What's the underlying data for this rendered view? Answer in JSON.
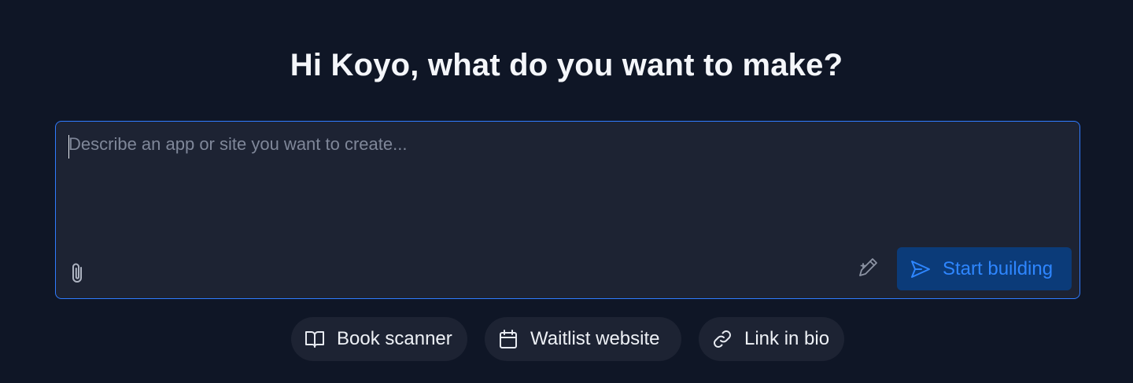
{
  "heading": "Hi Koyo, what do you want to make?",
  "prompt": {
    "placeholder": "Describe an app or site you want to create...",
    "value": ""
  },
  "actions": {
    "attach_icon": "paperclip-icon",
    "enhance_icon": "pen-sparkle-icon",
    "start_label": "Start building",
    "start_icon": "send-icon"
  },
  "suggestions": [
    {
      "label": "Book scanner",
      "icon": "book-icon"
    },
    {
      "label": "Waitlist website",
      "icon": "calendar-icon"
    },
    {
      "label": "Link in bio",
      "icon": "link-icon"
    }
  ],
  "colors": {
    "background": "#0f1626",
    "surface": "#1d2333",
    "accent": "#2f7bff",
    "start_button_bg": "#0b3b79",
    "start_button_text": "#2e86ff"
  }
}
